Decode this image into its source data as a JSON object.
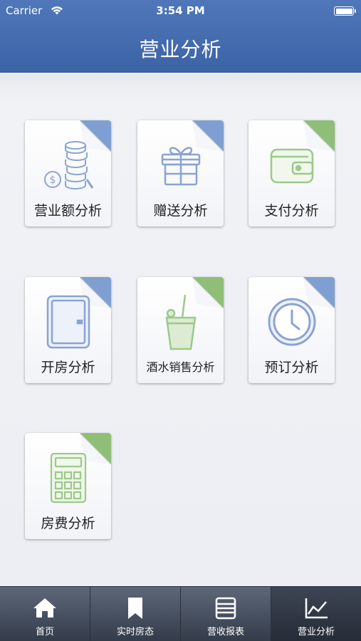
{
  "status_bar": {
    "carrier": "Carrier",
    "time": "3:54 PM"
  },
  "header": {
    "title": "营业分析"
  },
  "tiles": [
    {
      "label": "营业额分析",
      "icon": "coins-icon",
      "accent": "#7f9fd2"
    },
    {
      "label": "赠送分析",
      "icon": "gift-icon",
      "accent": "#7f9fd2"
    },
    {
      "label": "支付分析",
      "icon": "wallet-icon",
      "accent": "#8fbf76"
    },
    {
      "label": "开房分析",
      "icon": "door-icon",
      "accent": "#7f9fd2"
    },
    {
      "label": "酒水销售分析",
      "icon": "drink-icon",
      "accent": "#8fbf76"
    },
    {
      "label": "预订分析",
      "icon": "clock-icon",
      "accent": "#7f9fd2"
    },
    {
      "label": "房费分析",
      "icon": "calculator-icon",
      "accent": "#8fbf76"
    }
  ],
  "tabbar": {
    "items": [
      {
        "label": "首页",
        "icon": "home-icon"
      },
      {
        "label": "实时房态",
        "icon": "bookmark-icon"
      },
      {
        "label": "营收报表",
        "icon": "report-icon"
      },
      {
        "label": "营业分析",
        "icon": "chart-line-icon"
      }
    ],
    "active": "营业分析"
  }
}
